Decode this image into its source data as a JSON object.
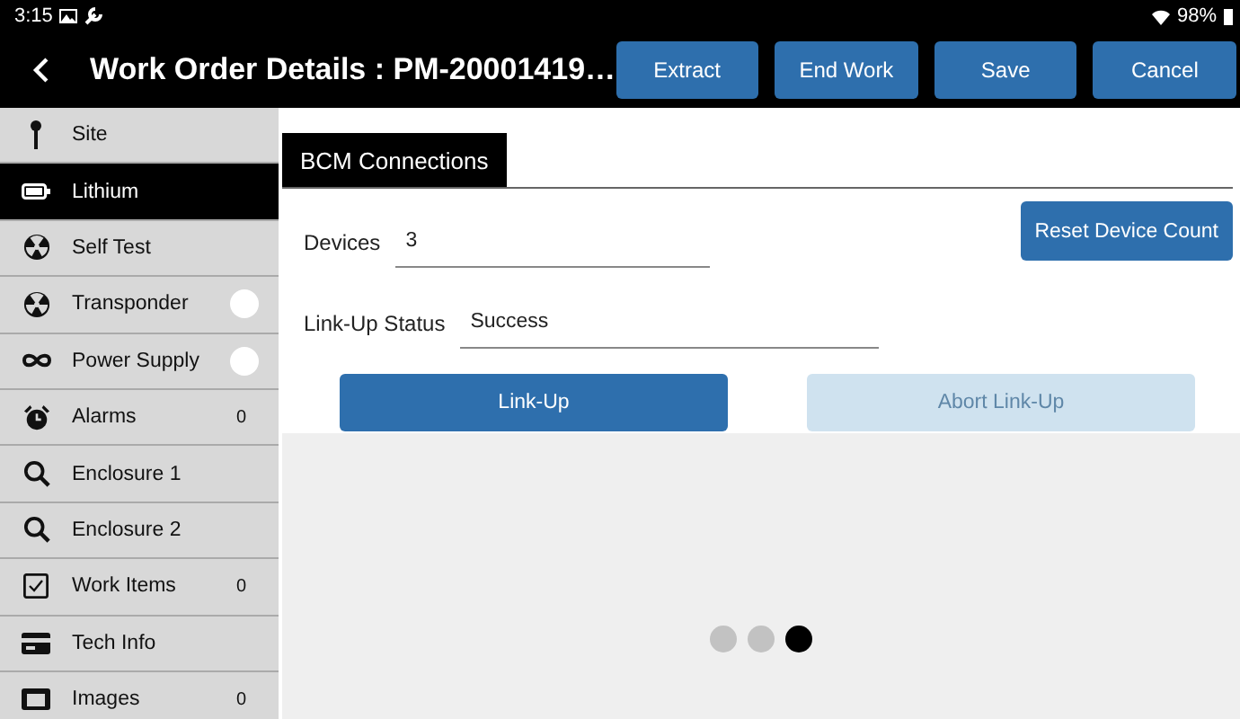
{
  "status_bar": {
    "time": "3:15",
    "battery": "98%"
  },
  "header": {
    "title": "Work Order Details : PM-20001419…",
    "buttons": [
      "Extract",
      "End Work",
      "Save",
      "Cancel"
    ]
  },
  "sidebar": {
    "items": [
      {
        "label": "Site",
        "selected": false
      },
      {
        "label": "Lithium",
        "selected": true
      },
      {
        "label": "Self Test",
        "selected": false
      },
      {
        "label": "Transponder",
        "selected": false,
        "indicator": true
      },
      {
        "label": "Power Supply",
        "selected": false,
        "indicator": true
      },
      {
        "label": "Alarms",
        "selected": false,
        "count": "0"
      },
      {
        "label": "Enclosure 1",
        "selected": false
      },
      {
        "label": "Enclosure 2",
        "selected": false
      },
      {
        "label": "Work Items",
        "selected": false,
        "count": "0"
      },
      {
        "label": "Tech Info",
        "selected": false
      },
      {
        "label": "Images",
        "selected": false,
        "count": "0"
      }
    ]
  },
  "tabs": [
    {
      "label": "BCM Connections",
      "selected": true
    }
  ],
  "form": {
    "fields": [
      {
        "label": "Devices",
        "value": "3"
      },
      {
        "label": "Link-Up Status",
        "value": "Success"
      }
    ],
    "reset_button": "Reset Device Count",
    "actions": [
      {
        "label": "Link-Up",
        "disabled": false
      },
      {
        "label": "Abort Link-Up",
        "disabled": true
      }
    ]
  },
  "pager": [
    {
      "selected": false
    },
    {
      "selected": false
    },
    {
      "selected": true
    }
  ]
}
